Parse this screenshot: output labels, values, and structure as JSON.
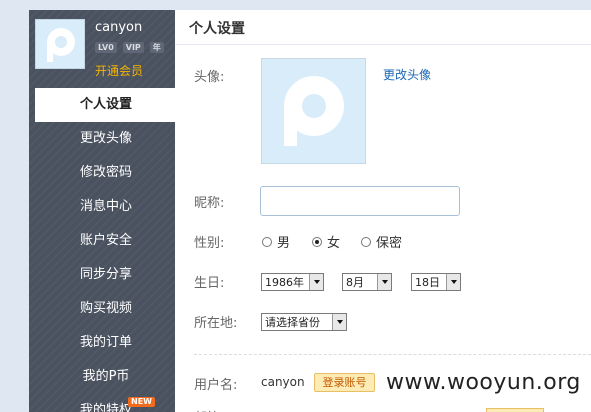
{
  "profile": {
    "username": "canyon",
    "badge_lv": "LV0",
    "badge_vip": "VIP",
    "badge_year": "年",
    "open_vip": "开通会员"
  },
  "menu": [
    {
      "label": "个人设置",
      "active": true
    },
    {
      "label": "更改头像"
    },
    {
      "label": "修改密码"
    },
    {
      "label": "消息中心"
    },
    {
      "label": "账户安全"
    },
    {
      "label": "同步分享"
    },
    {
      "label": "购买视频"
    },
    {
      "label": "我的订单"
    },
    {
      "label": "我的P币"
    },
    {
      "label": "我的特权",
      "tag": "NEW"
    }
  ],
  "main": {
    "title": "个人设置",
    "avatar_label": "头像:",
    "change_avatar": "更改头像",
    "nickname_label": "昵称:",
    "nickname_value": "",
    "gender_label": "性别:",
    "gender_options": [
      "男",
      "女",
      "保密"
    ],
    "gender_selected": "女",
    "birthday_label": "生日:",
    "birth_year": "1986年",
    "birth_month": "8月",
    "birth_day": "18日",
    "location_label": "所在地:",
    "location_value": "请选择省份",
    "username_label": "用户名:",
    "username_value": "canyon",
    "login_account": "登录账号",
    "email_label_partial": "邮箱"
  },
  "watermark": "www.wooyun.org",
  "colors": {
    "sidebar_bg": "#4a5260",
    "vip_gold": "#f7b500",
    "link_blue": "#1a66b5",
    "avatar_bg": "#d8ecfa",
    "new_tag": "#f26b1d"
  }
}
